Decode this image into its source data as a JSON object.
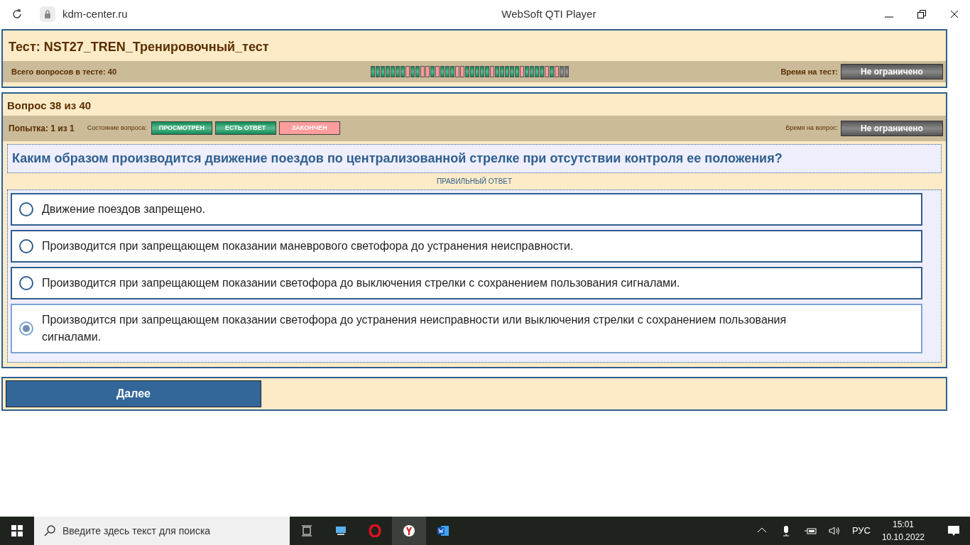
{
  "browser": {
    "address": "kdm-center.ru",
    "title": "WebSoft QTI Player"
  },
  "test": {
    "title": "Тест: NST27_TREN_Тренировочный_тест",
    "total_label": "Всего вопросов в тесте: 40",
    "time_label": "Время на тест:",
    "time_value": "Не ограничено",
    "progress": [
      {
        "kind": "answered"
      },
      {
        "kind": "answered"
      },
      {
        "kind": "answered"
      },
      {
        "kind": "answered"
      },
      {
        "kind": "answered"
      },
      {
        "kind": "answered"
      },
      {
        "kind": "answered"
      },
      {
        "kind": "finished"
      },
      {
        "kind": "answered"
      },
      {
        "kind": "answered"
      },
      {
        "kind": "finished"
      },
      {
        "kind": "finished"
      },
      {
        "kind": "answered"
      },
      {
        "kind": "finished"
      },
      {
        "kind": "answered"
      },
      {
        "kind": "answered"
      },
      {
        "kind": "answered"
      },
      {
        "kind": "finished"
      },
      {
        "kind": "finished"
      },
      {
        "kind": "answered"
      },
      {
        "kind": "answered"
      },
      {
        "kind": "answered"
      },
      {
        "kind": "answered"
      },
      {
        "kind": "answered"
      },
      {
        "kind": "finished"
      },
      {
        "kind": "answered"
      },
      {
        "kind": "answered"
      },
      {
        "kind": "answered"
      },
      {
        "kind": "answered"
      },
      {
        "kind": "answered"
      },
      {
        "kind": "finished"
      },
      {
        "kind": "answered"
      },
      {
        "kind": "answered"
      },
      {
        "kind": "answered"
      },
      {
        "kind": "answered"
      },
      {
        "kind": "finished"
      },
      {
        "kind": "answered"
      },
      {
        "kind": "finished"
      },
      {
        "kind": "unseen"
      },
      {
        "kind": "unseen"
      }
    ]
  },
  "question": {
    "title": "Вопрос 38 из 40",
    "attempt": "Попытка: 1 из 1",
    "state_label": "Состояние вопроса:",
    "states": [
      {
        "label": "ПРОСМОТРЕН",
        "kind": "answered"
      },
      {
        "label": "ЕСТЬ ОТВЕТ",
        "kind": "answered"
      },
      {
        "label": "ЗАКОНЧЕН",
        "kind": "finished"
      }
    ],
    "time_label": "Время на вопрос:",
    "time_value": "Не ограничено",
    "text": "Каким образом производится движение поездов по централизованной стрелке при отсутствии контроля ее положения?",
    "answer_caption": "ПРАВИЛЬНЫЙ ОТВЕТ",
    "options": [
      {
        "text": "Движение поездов запрещено.",
        "selected": false
      },
      {
        "text": "Производится при запрещающем показании маневрового светофора до устранения неисправности.",
        "selected": false
      },
      {
        "text": "Производится при запрещающем показании светофора до выключения стрелки с сохранением пользования сигналами.",
        "selected": false
      },
      {
        "text": "Производится при запрещающем показании светофора до устранения неисправности или выключения стрелки с сохранением пользования сигналами.",
        "selected": true
      }
    ]
  },
  "next_button": "Далее",
  "taskbar": {
    "search_placeholder": "Введите здесь текст для поиска",
    "language": "РУС",
    "time": "15:01",
    "date": "10.10.2022"
  }
}
